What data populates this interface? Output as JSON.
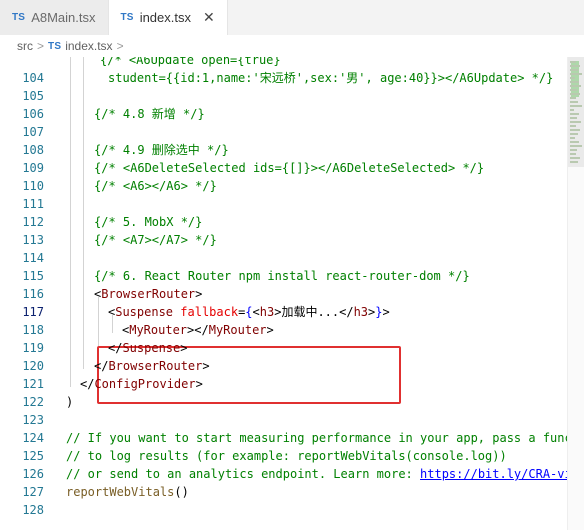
{
  "tabs": [
    {
      "badge": "TS",
      "label": "A8Main.tsx",
      "active": false
    },
    {
      "badge": "TS",
      "label": "index.tsx",
      "active": true,
      "close_icon": "close-icon"
    }
  ],
  "breadcrumb": {
    "root": "src",
    "separator": ">",
    "file_badge": "TS",
    "file": "index.tsx",
    "trailing_separator": ">"
  },
  "colors": {
    "comment": "#008000",
    "tag": "#800000",
    "attribute": "#e50000",
    "brace": "#0000ff",
    "line_number": "#237893",
    "highlight_box": "#e03030"
  },
  "editor": {
    "lines": [
      {
        "n": "",
        "segments": [
          {
            "t": "{/* <A6Update open={true}",
            "c": "comment"
          }
        ]
      },
      {
        "n": "104",
        "segments": [
          {
            "t": "student={{id:1,name:'宋远桥',sex:'男', age:40}}></A6Update> */}",
            "c": "comment"
          }
        ]
      },
      {
        "n": "105",
        "segments": []
      },
      {
        "n": "106",
        "segments": [
          {
            "t": "{/* 4.8 新增 */}",
            "c": "comment"
          }
        ]
      },
      {
        "n": "107",
        "segments": []
      },
      {
        "n": "108",
        "segments": [
          {
            "t": "{/* 4.9 删除选中 */}",
            "c": "comment"
          }
        ]
      },
      {
        "n": "109",
        "segments": [
          {
            "t": "{/* <A6DeleteSelected ids={[]}></A6DeleteSelected> */}",
            "c": "comment"
          }
        ]
      },
      {
        "n": "110",
        "segments": [
          {
            "t": "{/* <A6></A6> */}",
            "c": "comment"
          }
        ]
      },
      {
        "n": "111",
        "segments": []
      },
      {
        "n": "112",
        "segments": [
          {
            "t": "{/* 5. MobX */}",
            "c": "comment"
          }
        ]
      },
      {
        "n": "113",
        "segments": [
          {
            "t": "{/* <A7></A7> */}",
            "c": "comment"
          }
        ]
      },
      {
        "n": "114",
        "segments": []
      },
      {
        "n": "115",
        "segments": [
          {
            "t": "{/* 6. React Router npm install react-router-dom */}",
            "c": "comment"
          }
        ]
      },
      {
        "n": "116",
        "segments": [
          {
            "t": "<",
            "c": "punct"
          },
          {
            "t": "BrowserRouter",
            "c": "tag"
          },
          {
            "t": ">",
            "c": "punct"
          }
        ]
      },
      {
        "n": "117",
        "segments": [
          {
            "t": "<",
            "c": "punct"
          },
          {
            "t": "Suspense",
            "c": "tag"
          },
          {
            "t": " ",
            "c": "punct"
          },
          {
            "t": "fallback",
            "c": "attr"
          },
          {
            "t": "=",
            "c": "punct"
          },
          {
            "t": "{",
            "c": "brace"
          },
          {
            "t": "<",
            "c": "punct"
          },
          {
            "t": "h3",
            "c": "tag"
          },
          {
            "t": ">加载中...</",
            "c": "punct"
          },
          {
            "t": "h3",
            "c": "tag"
          },
          {
            "t": ">",
            "c": "punct"
          },
          {
            "t": "}",
            "c": "brace"
          },
          {
            "t": ">",
            "c": "punct"
          }
        ]
      },
      {
        "n": "118",
        "segments": [
          {
            "t": "<",
            "c": "punct"
          },
          {
            "t": "MyRouter",
            "c": "tag"
          },
          {
            "t": "></",
            "c": "punct"
          },
          {
            "t": "MyRouter",
            "c": "tag"
          },
          {
            "t": ">",
            "c": "punct"
          }
        ]
      },
      {
        "n": "119",
        "segments": [
          {
            "t": "</",
            "c": "punct"
          },
          {
            "t": "Suspense",
            "c": "tag"
          },
          {
            "t": ">",
            "c": "punct"
          }
        ]
      },
      {
        "n": "120",
        "segments": [
          {
            "t": "</",
            "c": "punct"
          },
          {
            "t": "BrowserRouter",
            "c": "tag"
          },
          {
            "t": ">",
            "c": "punct"
          }
        ]
      },
      {
        "n": "121",
        "segments": [
          {
            "t": "</",
            "c": "punct"
          },
          {
            "t": "ConfigProvider",
            "c": "tag"
          },
          {
            "t": ">",
            "c": "punct"
          }
        ]
      },
      {
        "n": "122",
        "segments": [
          {
            "t": ")",
            "c": "punct"
          }
        ]
      },
      {
        "n": "123",
        "segments": []
      },
      {
        "n": "124",
        "segments": [
          {
            "t": "// If you want to start measuring performance in your app, pass a func",
            "c": "comment"
          }
        ]
      },
      {
        "n": "125",
        "segments": [
          {
            "t": "// to log results (for example: reportWebVitals(console.log))",
            "c": "comment"
          }
        ]
      },
      {
        "n": "126",
        "segments": [
          {
            "t": "// or send to an analytics endpoint. Learn more: ",
            "c": "comment"
          },
          {
            "t": "https://bit.ly/CRA-vi",
            "c": "link"
          }
        ]
      },
      {
        "n": "127",
        "segments": [
          {
            "t": "reportWebVitals",
            "c": "fn"
          },
          {
            "t": "()",
            "c": "punct"
          }
        ]
      },
      {
        "n": "128",
        "segments": []
      }
    ]
  }
}
